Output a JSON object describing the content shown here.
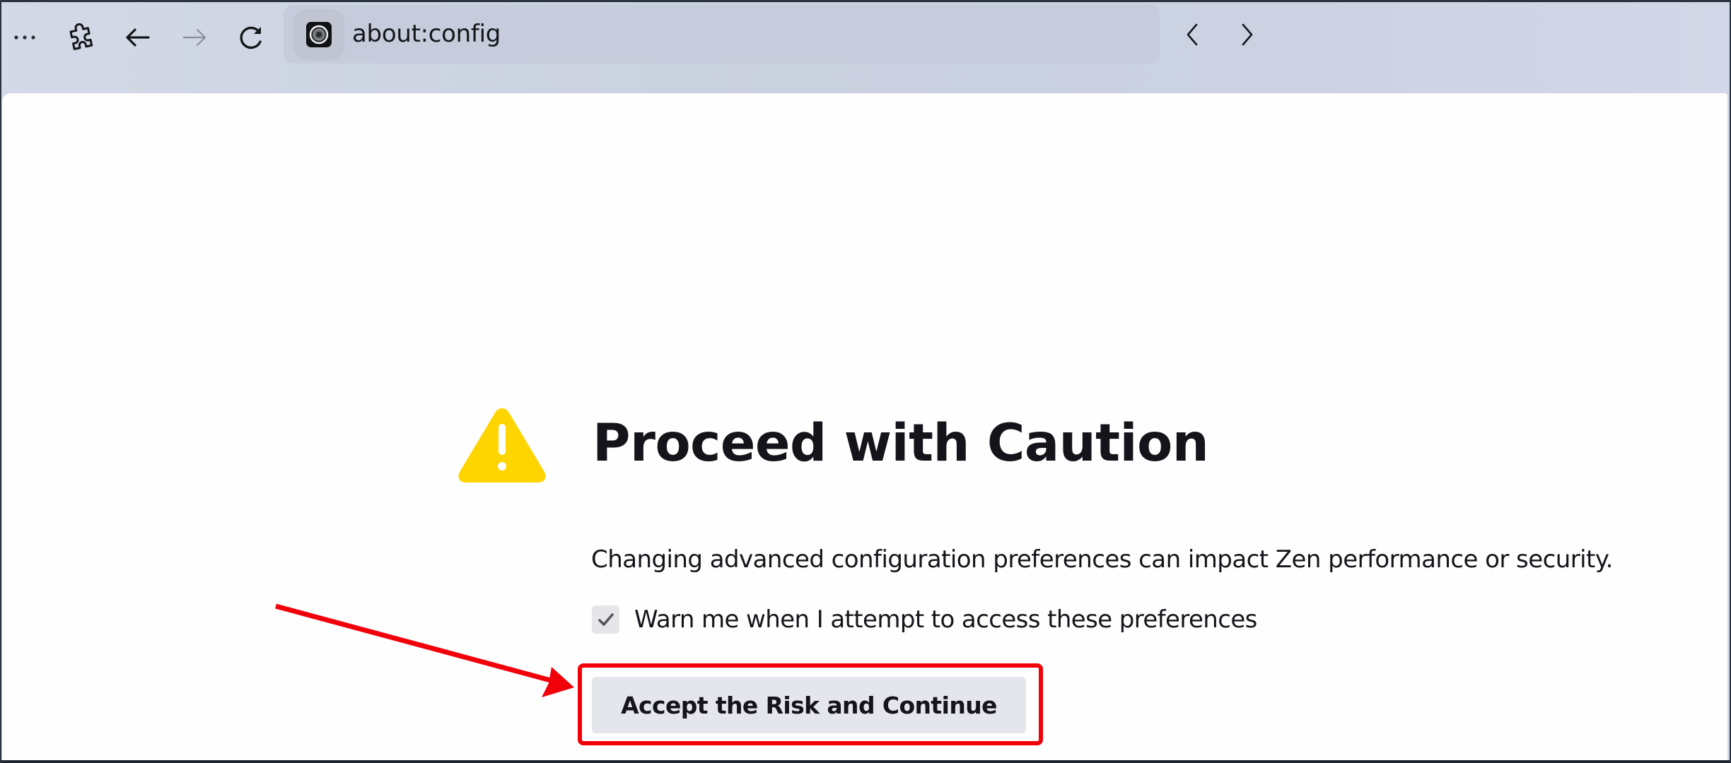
{
  "toolbar": {
    "menu_icon": "more-dots-icon",
    "extensions_icon": "puzzle-icon",
    "back_icon": "arrow-left-icon",
    "forward_icon": "arrow-right-icon",
    "forward_enabled": false,
    "reload_icon": "reload-icon"
  },
  "urlbar": {
    "site_icon": "zen-logo-icon",
    "url": "about:config"
  },
  "navigation": {
    "prev_icon": "chevron-left-icon",
    "next_icon": "chevron-right-icon"
  },
  "page": {
    "warning_icon": "warning-triangle-icon",
    "warning_color": "#ffd500",
    "heading": "Proceed with Caution",
    "description": "Changing advanced configuration preferences can impact Zen performance or security.",
    "warn_checkbox": {
      "label": "Warn me when I attempt to access these preferences",
      "checked": true
    },
    "accept_button_label": "Accept the Risk and Continue"
  },
  "annotation": {
    "color": "#f2000a",
    "target": "accept-button",
    "shapes": [
      "arrow",
      "highlight-rectangle"
    ]
  }
}
